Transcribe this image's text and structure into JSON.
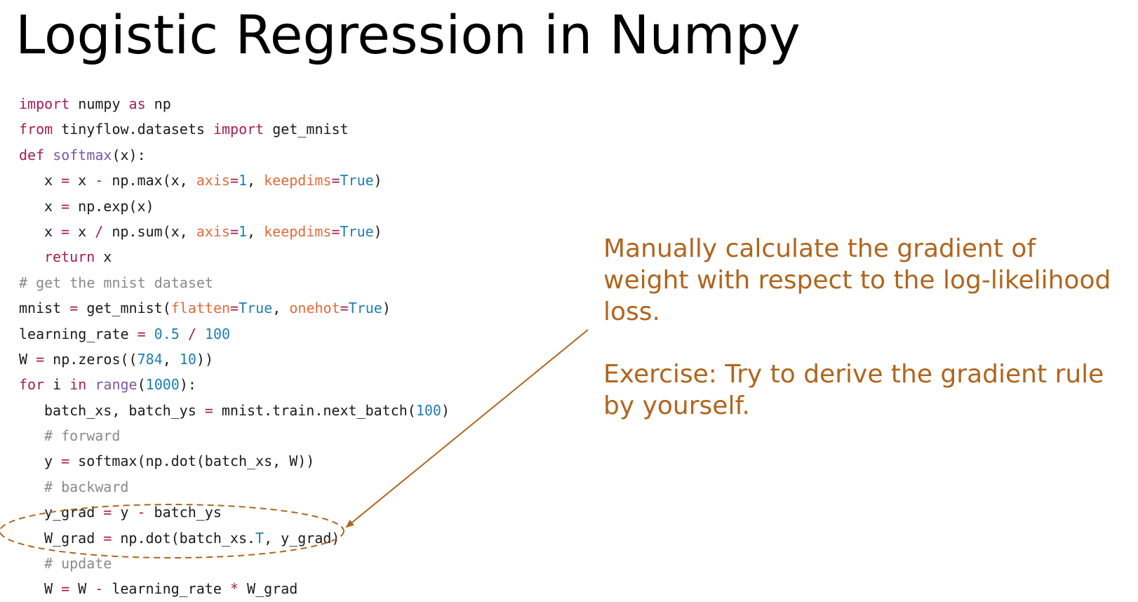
{
  "slide": {
    "title": "Logistic Regression in Numpy",
    "annotation_color": "#b0651d"
  },
  "code": {
    "lines": [
      {
        "indent": 0,
        "tokens": [
          {
            "t": "import",
            "k": "kw"
          },
          {
            "t": " numpy ",
            "k": "plain"
          },
          {
            "t": "as",
            "k": "kw"
          },
          {
            "t": " np",
            "k": "plain"
          }
        ]
      },
      {
        "indent": 0,
        "tokens": [
          {
            "t": "from",
            "k": "kw"
          },
          {
            "t": " tinyflow.datasets ",
            "k": "plain"
          },
          {
            "t": "import",
            "k": "kw"
          },
          {
            "t": " get_mnist",
            "k": "plain"
          }
        ]
      },
      {
        "indent": 0,
        "tokens": [
          {
            "t": "def",
            "k": "kw"
          },
          {
            "t": " ",
            "k": "plain"
          },
          {
            "t": "softmax",
            "k": "fn"
          },
          {
            "t": "(x):",
            "k": "plain"
          }
        ]
      },
      {
        "indent": 1,
        "tokens": [
          {
            "t": "x ",
            "k": "plain"
          },
          {
            "t": "=",
            "k": "op"
          },
          {
            "t": " x ",
            "k": "plain"
          },
          {
            "t": "-",
            "k": "op"
          },
          {
            "t": " np.max(x, ",
            "k": "plain"
          },
          {
            "t": "axis",
            "k": "param"
          },
          {
            "t": "=",
            "k": "op"
          },
          {
            "t": "1",
            "k": "num"
          },
          {
            "t": ", ",
            "k": "plain"
          },
          {
            "t": "keepdims",
            "k": "param"
          },
          {
            "t": "=",
            "k": "op"
          },
          {
            "t": "True",
            "k": "num"
          },
          {
            "t": ")",
            "k": "plain"
          }
        ]
      },
      {
        "indent": 1,
        "tokens": [
          {
            "t": "x ",
            "k": "plain"
          },
          {
            "t": "=",
            "k": "op"
          },
          {
            "t": " np.exp(x)",
            "k": "plain"
          }
        ]
      },
      {
        "indent": 1,
        "tokens": [
          {
            "t": "x ",
            "k": "plain"
          },
          {
            "t": "=",
            "k": "op"
          },
          {
            "t": " x ",
            "k": "plain"
          },
          {
            "t": "/",
            "k": "op"
          },
          {
            "t": " np.sum(x, ",
            "k": "plain"
          },
          {
            "t": "axis",
            "k": "param"
          },
          {
            "t": "=",
            "k": "op"
          },
          {
            "t": "1",
            "k": "num"
          },
          {
            "t": ", ",
            "k": "plain"
          },
          {
            "t": "keepdims",
            "k": "param"
          },
          {
            "t": "=",
            "k": "op"
          },
          {
            "t": "True",
            "k": "num"
          },
          {
            "t": ")",
            "k": "plain"
          }
        ]
      },
      {
        "indent": 1,
        "tokens": [
          {
            "t": "return",
            "k": "kw"
          },
          {
            "t": " x",
            "k": "plain"
          }
        ]
      },
      {
        "indent": 0,
        "tokens": [
          {
            "t": "# get the mnist dataset",
            "k": "comment"
          }
        ]
      },
      {
        "indent": 0,
        "tokens": [
          {
            "t": "mnist ",
            "k": "plain"
          },
          {
            "t": "=",
            "k": "op"
          },
          {
            "t": " get_mnist(",
            "k": "plain"
          },
          {
            "t": "flatten",
            "k": "param"
          },
          {
            "t": "=",
            "k": "op"
          },
          {
            "t": "True",
            "k": "num"
          },
          {
            "t": ", ",
            "k": "plain"
          },
          {
            "t": "onehot",
            "k": "param"
          },
          {
            "t": "=",
            "k": "op"
          },
          {
            "t": "True",
            "k": "num"
          },
          {
            "t": ")",
            "k": "plain"
          }
        ]
      },
      {
        "indent": 0,
        "tokens": [
          {
            "t": "learning_rate ",
            "k": "plain"
          },
          {
            "t": "=",
            "k": "op"
          },
          {
            "t": " ",
            "k": "plain"
          },
          {
            "t": "0.5",
            "k": "num"
          },
          {
            "t": " ",
            "k": "plain"
          },
          {
            "t": "/",
            "k": "op"
          },
          {
            "t": " ",
            "k": "plain"
          },
          {
            "t": "100",
            "k": "num"
          }
        ]
      },
      {
        "indent": 0,
        "tokens": [
          {
            "t": "W ",
            "k": "plain"
          },
          {
            "t": "=",
            "k": "op"
          },
          {
            "t": " np.zeros((",
            "k": "plain"
          },
          {
            "t": "784",
            "k": "num"
          },
          {
            "t": ", ",
            "k": "plain"
          },
          {
            "t": "10",
            "k": "num"
          },
          {
            "t": "))",
            "k": "plain"
          }
        ]
      },
      {
        "indent": 0,
        "tokens": [
          {
            "t": "for",
            "k": "kw"
          },
          {
            "t": " i ",
            "k": "plain"
          },
          {
            "t": "in",
            "k": "kw"
          },
          {
            "t": " ",
            "k": "plain"
          },
          {
            "t": "range",
            "k": "fn"
          },
          {
            "t": "(",
            "k": "plain"
          },
          {
            "t": "1000",
            "k": "num"
          },
          {
            "t": "):",
            "k": "plain"
          }
        ]
      },
      {
        "indent": 1,
        "tokens": [
          {
            "t": "batch_xs, batch_ys ",
            "k": "plain"
          },
          {
            "t": "=",
            "k": "op"
          },
          {
            "t": " mnist.train.next_batch(",
            "k": "plain"
          },
          {
            "t": "100",
            "k": "num"
          },
          {
            "t": ")",
            "k": "plain"
          }
        ]
      },
      {
        "indent": 1,
        "tokens": [
          {
            "t": "# forward",
            "k": "comment"
          }
        ]
      },
      {
        "indent": 1,
        "tokens": [
          {
            "t": "y ",
            "k": "plain"
          },
          {
            "t": "=",
            "k": "op"
          },
          {
            "t": " softmax(np.dot(batch_xs, W))",
            "k": "plain"
          }
        ]
      },
      {
        "indent": 1,
        "tokens": [
          {
            "t": "# backward",
            "k": "comment"
          }
        ]
      },
      {
        "indent": 1,
        "tokens": [
          {
            "t": "y_grad ",
            "k": "plain"
          },
          {
            "t": "=",
            "k": "op"
          },
          {
            "t": " y ",
            "k": "plain"
          },
          {
            "t": "-",
            "k": "op"
          },
          {
            "t": " batch_ys",
            "k": "plain"
          }
        ]
      },
      {
        "indent": 1,
        "tokens": [
          {
            "t": "W_grad ",
            "k": "plain"
          },
          {
            "t": "=",
            "k": "op"
          },
          {
            "t": " np.dot(batch_xs.",
            "k": "plain"
          },
          {
            "t": "T",
            "k": "num"
          },
          {
            "t": ", y_grad)",
            "k": "plain"
          }
        ]
      },
      {
        "indent": 1,
        "tokens": [
          {
            "t": "# update",
            "k": "comment"
          }
        ]
      },
      {
        "indent": 1,
        "tokens": [
          {
            "t": "W ",
            "k": "plain"
          },
          {
            "t": "=",
            "k": "op"
          },
          {
            "t": " W ",
            "k": "plain"
          },
          {
            "t": "-",
            "k": "op"
          },
          {
            "t": " learning_rate ",
            "k": "plain"
          },
          {
            "t": "*",
            "k": "op"
          },
          {
            "t": " W_grad",
            "k": "plain"
          }
        ]
      }
    ]
  },
  "note": {
    "text_1": "Manually calculate the gradient of weight with respect to the log-likelihood loss.",
    "text_2": "Exercise: Try to derive the gradient rule by yourself."
  }
}
